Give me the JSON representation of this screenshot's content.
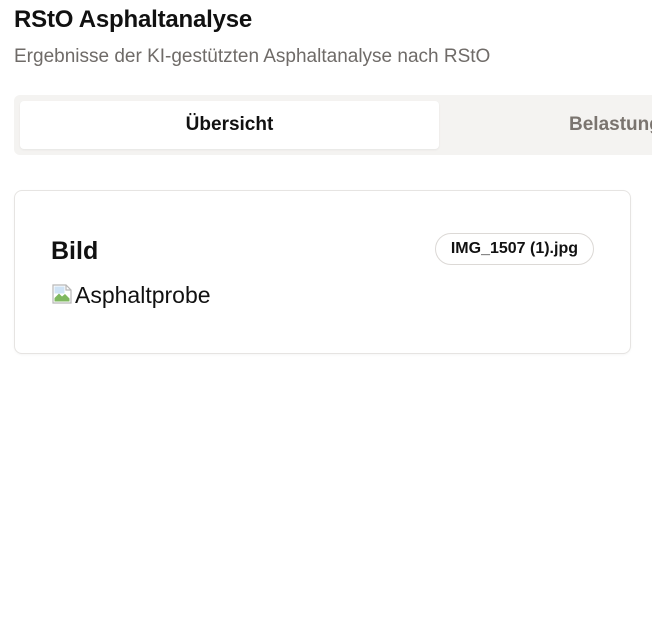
{
  "header": {
    "title": "RStO Asphaltanalyse",
    "subtitle": "Ergebnisse der KI-gestützten Asphaltanalyse nach RStO"
  },
  "tabs": [
    {
      "label": "Übersicht",
      "active": true
    },
    {
      "label": "Belastungsklasse",
      "active": false
    }
  ],
  "image_card": {
    "title": "Bild",
    "filename": "IMG_1507 (1).jpg",
    "image_alt": "Asphaltprobe",
    "image_icon": "broken-image-icon"
  }
}
